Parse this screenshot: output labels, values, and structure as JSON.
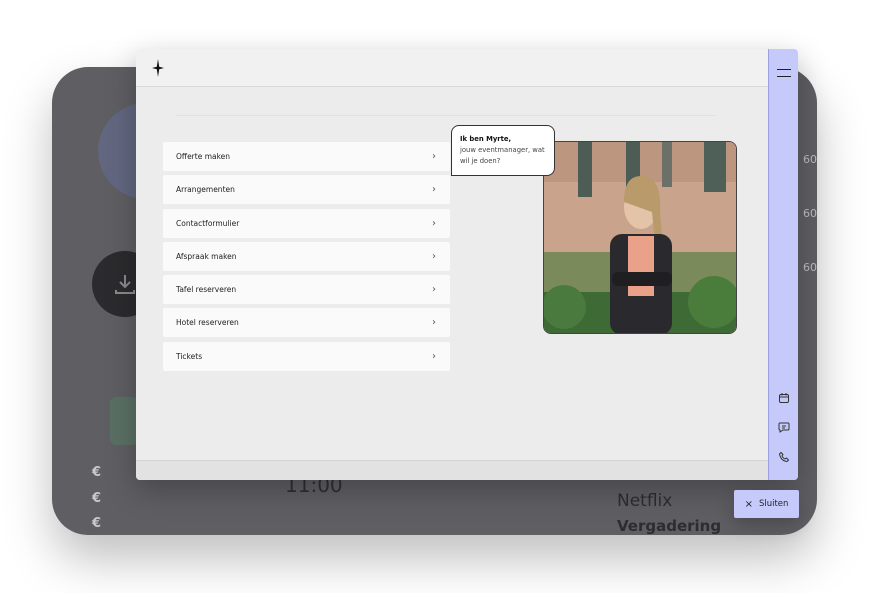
{
  "background": {
    "euro_symbols": [
      "€",
      "€",
      "€"
    ],
    "time": "11:00",
    "event1": "Netflix",
    "event2": "Vergadering",
    "side_values": [
      "60",
      "60",
      "60"
    ]
  },
  "bubble": {
    "greeting": "Ik ben Myrte,",
    "line2": "jouw eventmanager, wat",
    "line3": "wil je doen?"
  },
  "menu": [
    {
      "label": "Offerte maken"
    },
    {
      "label": "Arrangementen"
    },
    {
      "label": "Contactformulier"
    },
    {
      "label": "Afspraak maken"
    },
    {
      "label": "Tafel reserveren"
    },
    {
      "label": "Hotel reserveren"
    },
    {
      "label": "Tickets"
    }
  ],
  "close_button": {
    "label": "Sluiten",
    "icon": "close-icon"
  },
  "icons": {
    "logo": "diamond-logo",
    "menu": "hamburger-icon",
    "calendar": "calendar-icon",
    "chat": "chat-icon",
    "phone": "phone-icon",
    "chevron": "chevron-right-icon"
  },
  "colors": {
    "rail": "#c6cafa",
    "modal": "#ececec",
    "device": "#5e5e63"
  }
}
